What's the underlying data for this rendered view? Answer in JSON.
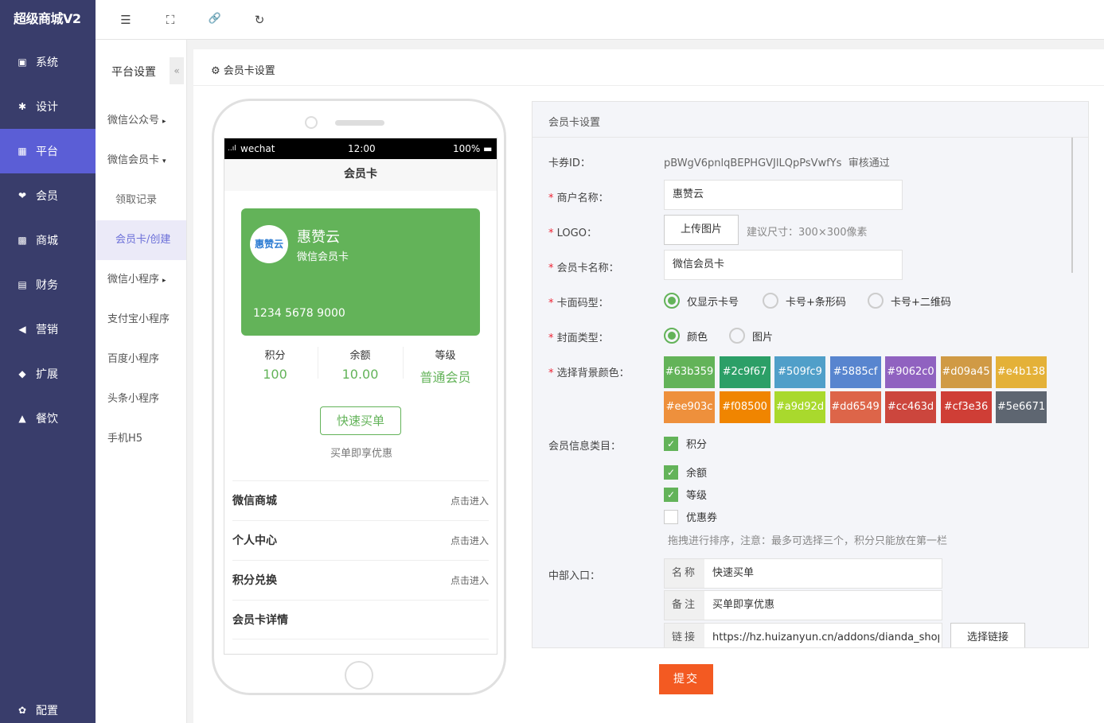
{
  "brand": "超级商城V2",
  "sidebar": {
    "items": [
      {
        "icon": "monitor-icon",
        "glyph": "▣",
        "label": "系统"
      },
      {
        "icon": "puzzle-icon",
        "glyph": "✱",
        "label": "设计"
      },
      {
        "icon": "grid-icon",
        "glyph": "▦",
        "label": "平台"
      },
      {
        "icon": "heart-icon",
        "glyph": "❤",
        "label": "会员"
      },
      {
        "icon": "shop-icon",
        "glyph": "▩",
        "label": "商城"
      },
      {
        "icon": "calculator-icon",
        "glyph": "▤",
        "label": "财务"
      },
      {
        "icon": "megaphone-icon",
        "glyph": "◀",
        "label": "营销"
      },
      {
        "icon": "cube-icon",
        "glyph": "◆",
        "label": "扩展"
      },
      {
        "icon": "cake-icon",
        "glyph": "▲",
        "label": "餐饮"
      }
    ],
    "active_index": 2,
    "config": {
      "icon": "gear-icon",
      "glyph": "✿",
      "label": "配置"
    }
  },
  "subnav": {
    "title": "平台设置",
    "collapse": "«",
    "items": [
      {
        "label": "微信公众号",
        "caret": "▸"
      },
      {
        "label": "微信会员卡",
        "caret": "▾"
      },
      {
        "label": "领取记录"
      },
      {
        "label": "会员卡/创建"
      },
      {
        "label": "微信小程序",
        "caret": "▸"
      },
      {
        "label": "支付宝小程序"
      },
      {
        "label": "百度小程序"
      },
      {
        "label": "头条小程序"
      },
      {
        "label": "手机H5"
      }
    ]
  },
  "topbar": {
    "menu_glyph": "☰",
    "fullscreen_glyph": "⛶",
    "link_glyph": "🔗",
    "refresh_glyph": "↻"
  },
  "page_title": "会员卡设置",
  "page_title_icon": "⚙",
  "phone": {
    "carrier": "wechat",
    "signal": "..ıl",
    "time": "12:00",
    "battery": "100% ▬",
    "screen_title": "会员卡",
    "card": {
      "logo_text": "惠赞云",
      "name": "惠赞云",
      "subtitle": "微信会员卡",
      "number": "1234 5678 9000",
      "color": "#63b359"
    },
    "stats": [
      {
        "label": "积分",
        "value": "100"
      },
      {
        "label": "余额",
        "value": "10.00"
      },
      {
        "label": "等级",
        "value": "普通会员"
      }
    ],
    "quick_button": "快速买单",
    "quick_sub": "买单即享优惠",
    "rows": [
      {
        "label": "微信商城",
        "action": "点击进入"
      },
      {
        "label": "个人中心",
        "action": "点击进入"
      },
      {
        "label": "积分兑换",
        "action": "点击进入"
      },
      {
        "label": "会员卡详情",
        "action": ""
      }
    ]
  },
  "form": {
    "title": "会员卡设置",
    "card_id_label": "卡券ID：",
    "card_id_value": "pBWgV6pnlqBEPHGVJlLQpPsVwfYs",
    "card_id_status": "审核通过",
    "merchant_label": "商户名称：",
    "merchant_value": "惠赞云",
    "logo_label": "LOGO：",
    "upload_button": "上传图片",
    "logo_hint": "建议尺寸：300×300像素",
    "card_name_label": "会员卡名称：",
    "card_name_value": "微信会员卡",
    "code_type_label": "卡面码型：",
    "code_type_options": [
      "仅显示卡号",
      "卡号+条形码",
      "卡号+二维码"
    ],
    "code_type_selected": 0,
    "cover_type_label": "封面类型：",
    "cover_type_options": [
      "颜色",
      "图片"
    ],
    "cover_type_selected": 0,
    "bg_color_label": "选择背景颜色：",
    "colors": [
      "#63b359",
      "#2c9f67",
      "#509fc9",
      "#5885cf",
      "#9062c0",
      "#d09a45",
      "#e4b138",
      "#ee903c",
      "#f08500",
      "#a9d92d",
      "#dd6549",
      "#cc463d",
      "#cf3e36",
      "#5e6671"
    ],
    "info_label": "会员信息类目：",
    "info_items": [
      {
        "label": "积分",
        "checked": true
      },
      {
        "label": "余额",
        "checked": true
      },
      {
        "label": "等级",
        "checked": true
      },
      {
        "label": "优惠券",
        "checked": false
      }
    ],
    "info_hint": "拖拽进行排序，注意：最多可选择三个，积分只能放在第一栏",
    "entry_label": "中部入口：",
    "entry_name_addon": "名称",
    "entry_name_value": "快速买单",
    "entry_note_addon": "备注",
    "entry_note_value": "买单即享优惠",
    "entry_link_addon": "链接",
    "entry_link_value": "https://hz.huizanyun.cn/addons/dianda_shop?",
    "select_link_button": "选择链接",
    "check_glyph": "✓"
  },
  "submit": "提交"
}
